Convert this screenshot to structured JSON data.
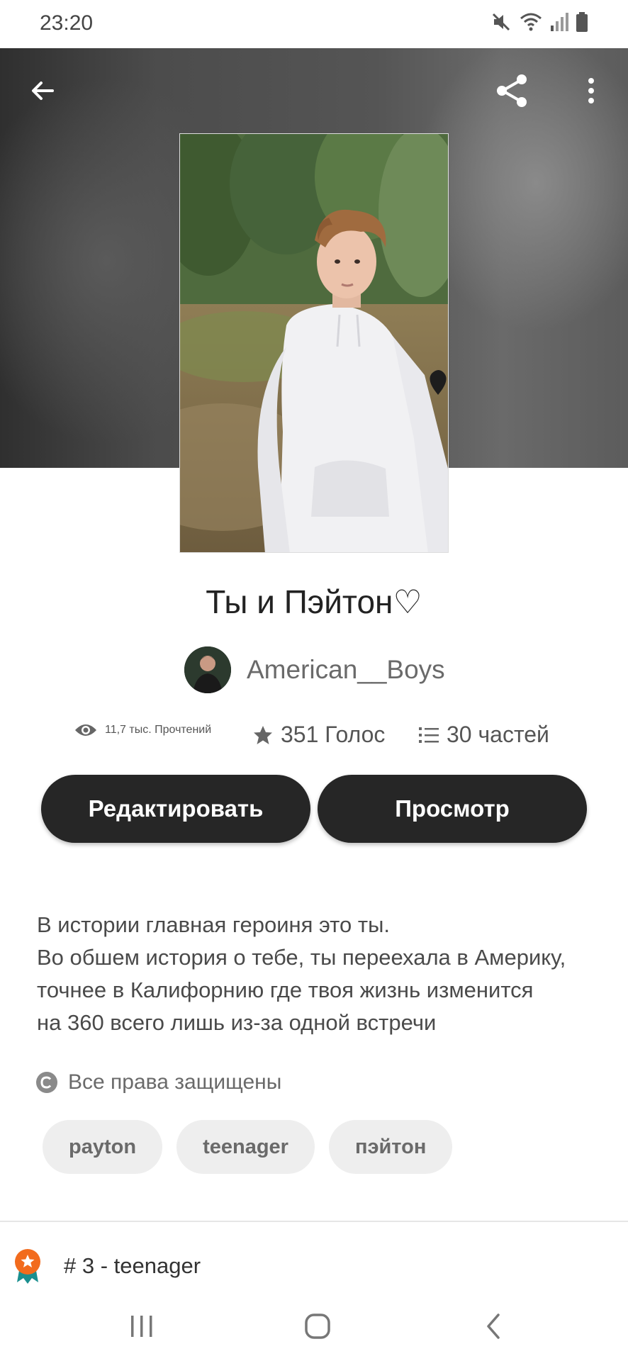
{
  "status_bar": {
    "time": "23:20",
    "icons": [
      "mute-icon",
      "wifi-icon",
      "signal-icon",
      "battery-icon"
    ]
  },
  "header": {
    "icons": [
      "back-arrow-icon",
      "share-icon",
      "more-vertical-icon"
    ]
  },
  "story": {
    "title": "Ты и Пэйтон♡",
    "author": "American__Boys",
    "stats": {
      "reads": "11,7 тыс. Прочтений",
      "votes": "351 Голос",
      "parts": "30 частей"
    },
    "buttons": {
      "edit": "Редактировать",
      "view": "Просмотр"
    },
    "description_lines": [
      "В истории главная героиня это ты.",
      "Во обшем история о тебе, ты переехала в Америку,",
      "точнее в Калифорнию где твоя жизнь изменится",
      "на 360 всего лишь из-за одной встречи"
    ],
    "copyright": "Все права защищены",
    "tags": [
      "payton",
      "teenager",
      "пэйтон"
    ],
    "rank": "# 3 - teenager"
  },
  "colors": {
    "button_bg": "#262626",
    "tag_bg": "#eeeeee",
    "rank_badge": "#f26b1d",
    "rank_ribbon": "#1a8f8f"
  }
}
